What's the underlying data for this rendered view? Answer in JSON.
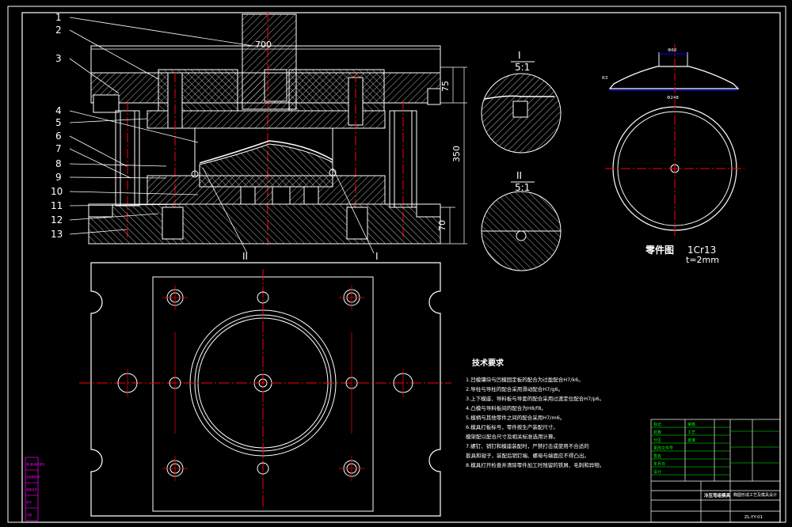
{
  "part_labels": [
    "1",
    "2",
    "3",
    "4",
    "5",
    "6",
    "7",
    "8",
    "9",
    "10",
    "11",
    "12",
    "13"
  ],
  "section_marks": {
    "left": "II",
    "right": "I"
  },
  "dimensions": {
    "width": "700",
    "height_total": "350",
    "height_top": "75",
    "height_bottom": "70"
  },
  "details": [
    {
      "title": "I",
      "scale": "5:1"
    },
    {
      "title": "II",
      "scale": "5:1"
    }
  ],
  "part_drawing": {
    "label": "零件图",
    "material": "1Cr13",
    "thickness": "t=2mm",
    "top_dim": "Φ60",
    "bottom_dim": "Φ248",
    "radius": "R3"
  },
  "tech_req": {
    "title": "技术要求",
    "items": [
      "1.凹模镶块与凹模固定板的配合为过盈配合H7/k6。",
      "2.导柱与导柱的配合采用滑动配合H7/g6。",
      "3.上下模座、导料板与导套的配合采用过渡定位配合H7/p6。",
      "4.凸模与导料板间的配合为H8/f8。",
      "5.模柄与其他零件之间的配合采用H7/m6。",
      "6.模具打板标号，零件按生产装配尺寸。",
      "   模架配以配合尺寸及相关标准选用计算。",
      "7.螺钉、销钉和模座装配时，严禁打击或使用不合适的",
      "   扳具和钳子，装配后销钉端、螺母与端面应不得凸出。",
      "8.模具打开检查并清除零件加工时残留的铁屑、毛刺和异物。"
    ]
  },
  "title_block": {
    "name": "冷压弯组模具",
    "drawing": "椭圆形成工艺及模具设计",
    "number": "ZL-YY-01",
    "rows": [
      "标记",
      "处数",
      "分区",
      "更改文件号",
      "签名",
      "年月日",
      "设计",
      "审核",
      "工艺",
      "批准"
    ]
  },
  "side_stamp": [
    "借(通)用件登记",
    "旧底图总号",
    "底图总号",
    "签字",
    "日期"
  ]
}
